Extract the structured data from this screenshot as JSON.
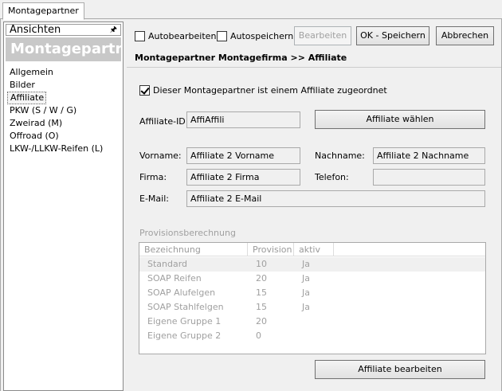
{
  "tab": {
    "label": "Montagepartner"
  },
  "left": {
    "views_label": "Ansichten",
    "pin_icon": "pin-icon",
    "title": "Montagepartner",
    "items": [
      {
        "label": "Allgemein"
      },
      {
        "label": "Bilder"
      },
      {
        "label": "Affiliate"
      },
      {
        "label": "PKW (S / W / G)"
      },
      {
        "label": "Zweirad (M)"
      },
      {
        "label": "Offroad (O)"
      },
      {
        "label": "LKW-/LLKW-Reifen (L)"
      }
    ],
    "selected_index": 2
  },
  "toolbar": {
    "autobearbeiten": "Autobearbeiten",
    "autospeichern": "Autospeichern",
    "bearbeiten": "Bearbeiten",
    "ok_speichern": "OK - Speichern",
    "abbrechen": "Abbrechen"
  },
  "breadcrumb": "Montagepartner Montagefirma >> Affiliate",
  "form": {
    "assigned_label": "Dieser Montagepartner ist einem Affiliate zugeordnet",
    "assigned_checked": true,
    "affiliate_id_label": "Affiliate-ID:",
    "affiliate_id_value": "AffiAffili",
    "choose_button": "Affiliate wählen",
    "vorname_label": "Vorname:",
    "vorname_value": "Affiliate 2 Vorname",
    "nachname_label": "Nachname:",
    "nachname_value": "Affiliate 2 Nachname",
    "firma_label": "Firma:",
    "firma_value": "Affiliate 2 Firma",
    "telefon_label": "Telefon:",
    "telefon_value": "",
    "email_label": "E-Mail:",
    "email_value": "Affiliate 2 E-Mail"
  },
  "provisions": {
    "title": "Provisionsberechnung",
    "columns": [
      "Bezeichnung",
      "Provision",
      "aktiv"
    ],
    "rows": [
      [
        "Standard",
        "10",
        "Ja"
      ],
      [
        "SOAP Reifen",
        "20",
        "Ja"
      ],
      [
        "SOAP Alufelgen",
        "15",
        "Ja"
      ],
      [
        "SOAP Stahlfelgen",
        "15",
        "Ja"
      ],
      [
        "Eigene Gruppe 1",
        "20",
        ""
      ],
      [
        "Eigene Gruppe 2",
        "0",
        ""
      ]
    ]
  },
  "edit_button": "Affiliate bearbeiten"
}
